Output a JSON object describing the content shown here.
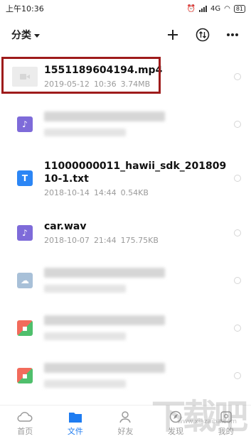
{
  "status_bar": {
    "time": "上午10:36",
    "network": "4G",
    "battery": "81"
  },
  "toolbar": {
    "category_label": "分类"
  },
  "files": [
    {
      "name": "1551189604194.mp4",
      "date": "2019-05-12",
      "time": "10:36",
      "size": "3.74MB",
      "icon": "video-icon",
      "color": "#eeeeee"
    },
    {
      "name": "",
      "date": "",
      "time": "",
      "size": "",
      "icon": "music-icon",
      "color": "#7e6bd9"
    },
    {
      "name": "11000000011_hawii_sdk_20180910-1.txt",
      "date": "2018-10-14",
      "time": "14:44",
      "size": "0.54KB",
      "icon": "text-file-icon",
      "color": "#2c86f5"
    },
    {
      "name": "car.wav",
      "date": "2018-10-07",
      "time": "21:44",
      "size": "175.75KB",
      "icon": "music-icon",
      "color": "#7e6bd9"
    },
    {
      "name": "",
      "icon": "cloud-file-icon",
      "color": "#a8c0d8"
    },
    {
      "name": "",
      "icon": "archive-icon",
      "color": "#e85a4f"
    },
    {
      "name": "",
      "icon": "archive-icon",
      "color": "#e85a4f"
    },
    {
      "name": "",
      "icon": "archive-icon",
      "color": "#e85a4f"
    }
  ],
  "bottom_nav": [
    {
      "label": "首页",
      "icon": "home-icon",
      "active": false
    },
    {
      "label": "文件",
      "icon": "folder-icon",
      "active": true
    },
    {
      "label": "好友",
      "icon": "friends-icon",
      "active": false
    },
    {
      "label": "发现",
      "icon": "discover-icon",
      "active": false
    },
    {
      "label": "我的",
      "icon": "profile-icon",
      "active": false
    }
  ],
  "watermark": {
    "text": "下载吧",
    "url": "www.xiazaiba.com"
  },
  "colors": {
    "accent": "#1e7cf1",
    "highlight_border": "#9e1b1b"
  }
}
